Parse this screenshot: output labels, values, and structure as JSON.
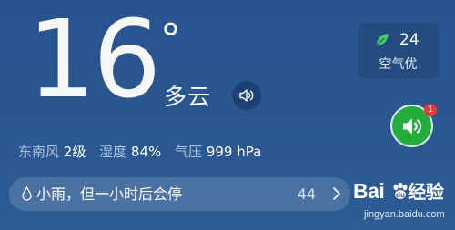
{
  "weather": {
    "temperature": "16",
    "degree_symbol": "°",
    "condition": "多云"
  },
  "air_quality": {
    "value": "24",
    "label": "空气优",
    "icon": "leaf-icon",
    "icon_color": "#3fcf5c"
  },
  "details": {
    "wind_label": "东南风",
    "wind_value": "2级",
    "humidity_label": "湿度",
    "humidity_value": "84%",
    "pressure_label": "气压",
    "pressure_value": "999 hPa"
  },
  "forecast": {
    "text": "小雨，但一小时后会停",
    "count": "44"
  },
  "voice_fab": {
    "badge": "1",
    "color": "#23ad3a"
  },
  "watermark": {
    "logo_text": "Bai",
    "logo_suffix": "经验",
    "url": "jingyan.baidu.com"
  }
}
